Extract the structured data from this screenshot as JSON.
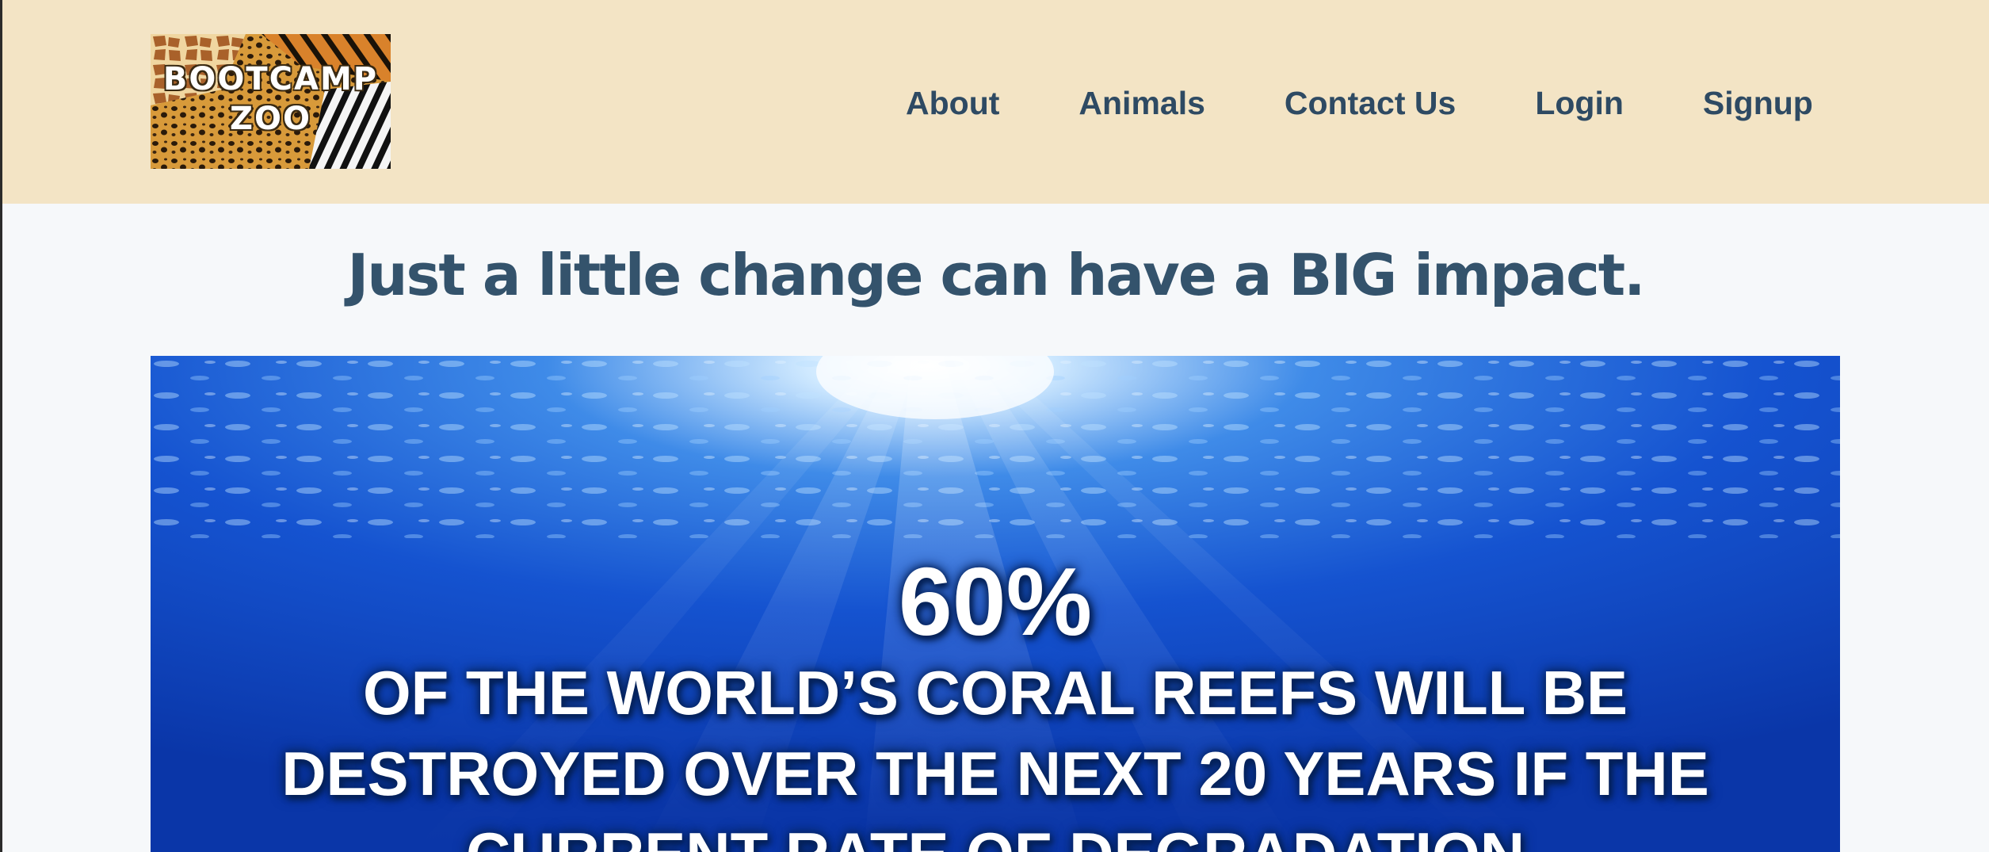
{
  "header": {
    "logo": {
      "line1": "BOOTCAMP",
      "line2": "ZOO"
    },
    "nav": [
      {
        "label": "About"
      },
      {
        "label": "Animals"
      },
      {
        "label": "Contact Us"
      },
      {
        "label": "Login"
      },
      {
        "label": "Signup"
      }
    ]
  },
  "main": {
    "headline": "Just a little change can have a BIG impact.",
    "hero": {
      "percent": "60%",
      "lines": [
        "OF THE WORLD’S CORAL REEFS WILL BE",
        "DESTROYED OVER THE NEXT 20 YEARS IF THE",
        "CURRENT RATE OF DEGRADATION"
      ]
    }
  },
  "colors": {
    "header_bg": "#f3e4c5",
    "page_bg": "#f6f8fa",
    "nav_text": "#2e4a63",
    "headline": "#34536c",
    "ocean": "#0a3fb8"
  }
}
